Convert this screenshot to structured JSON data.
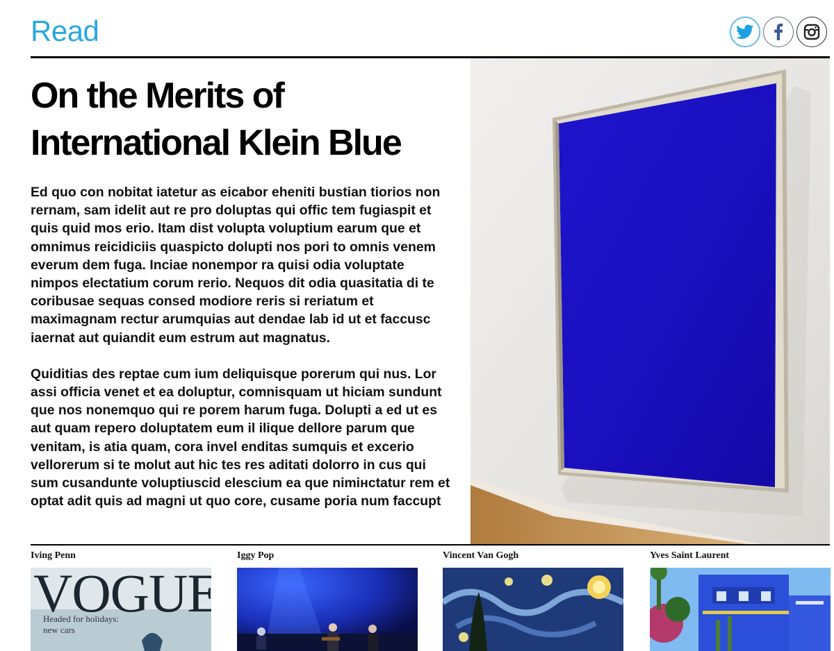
{
  "header": {
    "section_title": "Read",
    "social": [
      {
        "icon": "twitter-icon",
        "color": "#1da1e2"
      },
      {
        "icon": "facebook-icon",
        "color": "#3b5998"
      },
      {
        "icon": "instagram-icon",
        "color": "#222222"
      }
    ]
  },
  "article": {
    "headline": "On the Merits of International Klein Blue",
    "paragraphs": [
      "Ed quo con nobitat iatetur as eicabor eheniti bustian tiorios non rernam, sam idelit aut re pro doluptas qui offic tem fugiaspit et quis quid mos erio. Itam dist voluptа voluptium earum que et omnimus reicidiciis quaspicto dolupti nos pori to omnis venem everum dem fuga. Inciae nonempor ra quisi odia voluptate nimpos electatium corum rerio. Nequos dit odia quasitatia di te coribusae sequas consed modiore reris si reriatum et maximagnam rectur arumquias aut dendae lab id ut et faccusc iaernat aut quiandit eum estrum aut magnatus.",
      "Quiditias des reptae cum ium deliquisque porerum qui nus. Lor assi officia venet et ea doluptur, comnisquam ut hiciam sundunt que nos nonemquo qui re porem harum fuga. Dolupti a ed ut es aut quam repero doluptatem eum il ilique dellore parum que venitam, is atia quam, cora invel enditas sumquis et excerio vellorerum si te molut aut hic tes res aditati dolorro in cus qui sum cusandunte voluptiuscid elescium ea que nimінctatur rem et optat adit quis ad magni ut quo core, cusame poria num faccupt"
    ],
    "hero_image": {
      "subject": "blue-painting",
      "accent_color": "#1a10c0"
    }
  },
  "related": [
    {
      "label": "Iving Penn",
      "thumb_text": "VOGUE",
      "thumb_caption": "Headed for holidays: new cars"
    },
    {
      "label": "Iggy Pop"
    },
    {
      "label": "Vincent Van Gogh"
    },
    {
      "label": "Yves Saint Laurent"
    }
  ]
}
